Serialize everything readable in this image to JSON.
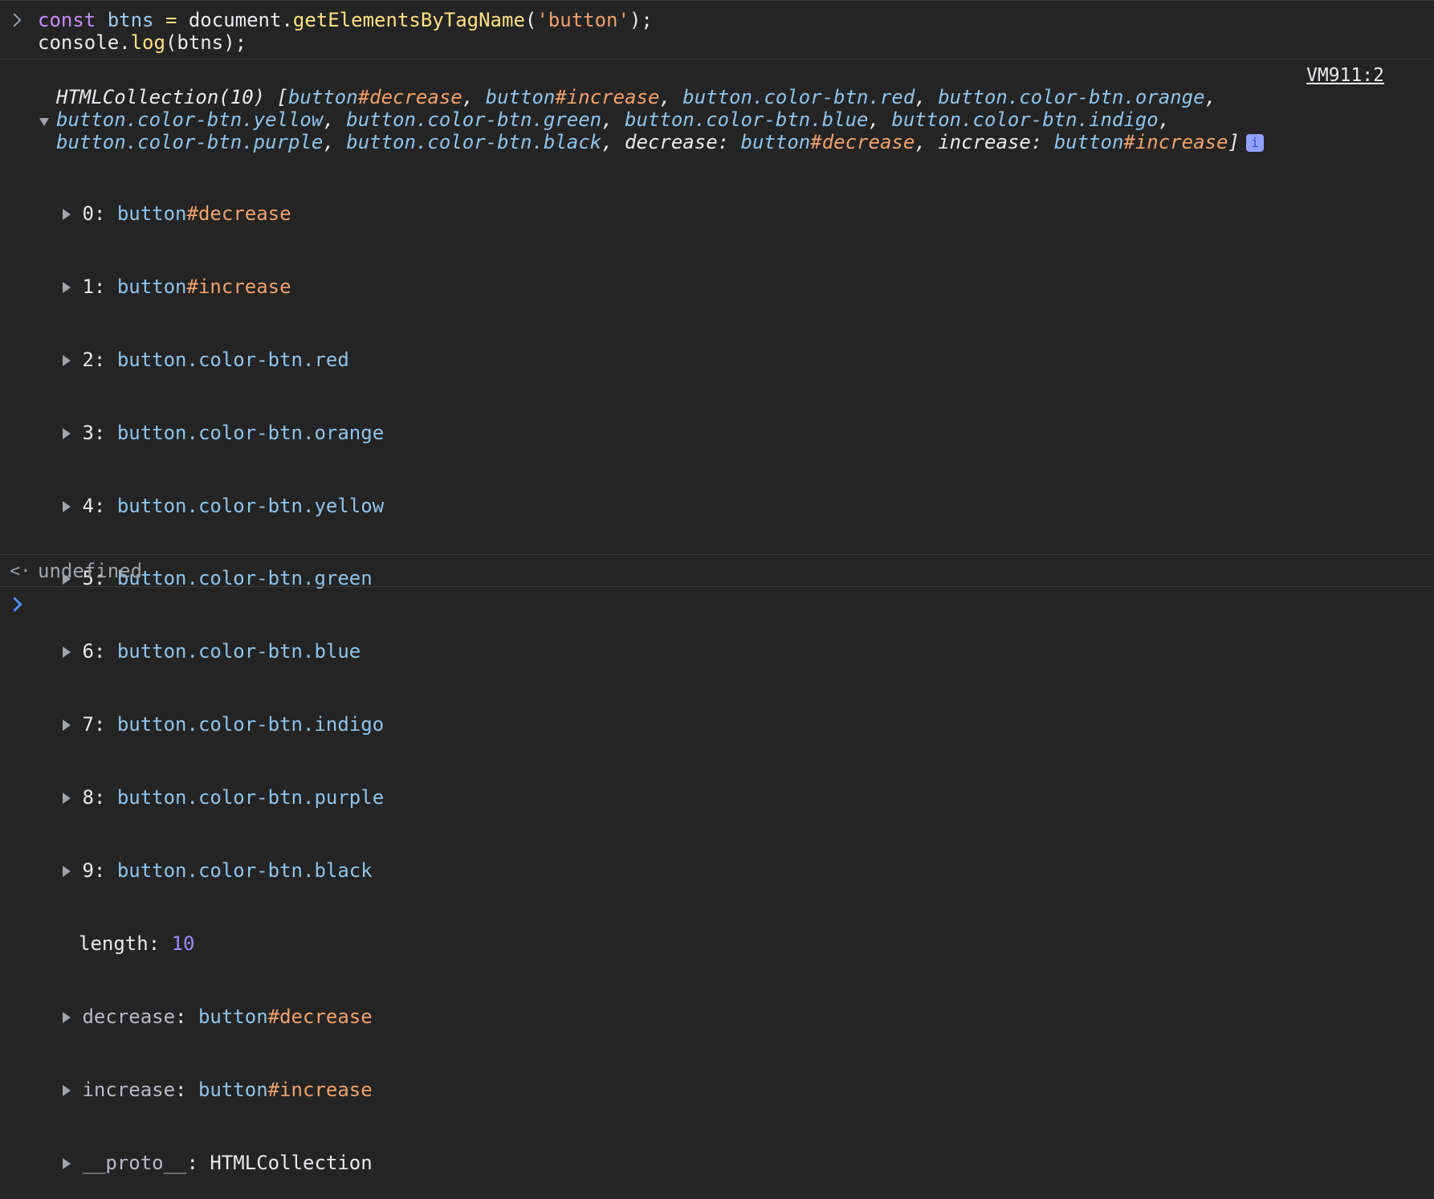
{
  "input": {
    "line1": {
      "kw": "const",
      "var": "btns",
      "op": "=",
      "obj": "document.",
      "fn": "getElementsByTagName",
      "open": "(",
      "str": "'button'",
      "close": ");"
    },
    "line2": {
      "obj": "console.",
      "fn": "log",
      "rest": "(btns);"
    }
  },
  "source_link": "VM911:2",
  "summary": {
    "prefix": "HTMLCollection(10) [",
    "line1": [
      {
        "tag": "button",
        "id": "#decrease",
        "sep": ", "
      },
      {
        "tag": "button",
        "id": "#increase",
        "sep": ", "
      },
      {
        "tag": "button.color-btn.red",
        "id": "",
        "sep": ", "
      },
      {
        "tag": "button.color-btn.orange",
        "id": "",
        "sep": ","
      }
    ],
    "line2": [
      {
        "tag": "button.color-btn.yellow",
        "id": "",
        "sep": ", "
      },
      {
        "tag": "button.color-btn.green",
        "id": "",
        "sep": ", "
      },
      {
        "tag": "button.color-btn.blue",
        "id": "",
        "sep": ", "
      },
      {
        "tag": "button.color-btn.indigo",
        "id": "",
        "sep": ","
      }
    ],
    "line3_items": [
      {
        "tag": "button.color-btn.purple",
        "sep": ", "
      },
      {
        "tag": "button.color-btn.black",
        "sep": ", "
      }
    ],
    "line3_named": [
      {
        "key": "decrease: ",
        "tag": "button",
        "id": "#decrease",
        "sep": ", "
      },
      {
        "key": "increase: ",
        "tag": "button",
        "id": "#increase",
        "sep": "]"
      }
    ],
    "info_icon": "i"
  },
  "entries": [
    {
      "index": "0",
      "tag": "button",
      "id": "#decrease"
    },
    {
      "index": "1",
      "tag": "button",
      "id": "#increase"
    },
    {
      "index": "2",
      "tag": "button.color-btn.red",
      "id": ""
    },
    {
      "index": "3",
      "tag": "button.color-btn.orange",
      "id": ""
    },
    {
      "index": "4",
      "tag": "button.color-btn.yellow",
      "id": ""
    },
    {
      "index": "5",
      "tag": "button.color-btn.green",
      "id": ""
    },
    {
      "index": "6",
      "tag": "button.color-btn.blue",
      "id": ""
    },
    {
      "index": "7",
      "tag": "button.color-btn.indigo",
      "id": ""
    },
    {
      "index": "8",
      "tag": "button.color-btn.purple",
      "id": ""
    },
    {
      "index": "9",
      "tag": "button.color-btn.black",
      "id": ""
    }
  ],
  "length_key": "length",
  "length_value": "10",
  "named": [
    {
      "key": "decrease",
      "tag": "button",
      "id": "#decrease"
    },
    {
      "key": "increase",
      "tag": "button",
      "id": "#increase"
    }
  ],
  "proto": {
    "key": "__proto__",
    "value": "HTMLCollection"
  },
  "result": "undefined",
  "icons": {
    "prompt": "chevron-right-icon",
    "expand": "triangle-right-icon",
    "collapse": "triangle-down-icon",
    "return": "return-arrow-icon",
    "info": "info-icon"
  }
}
